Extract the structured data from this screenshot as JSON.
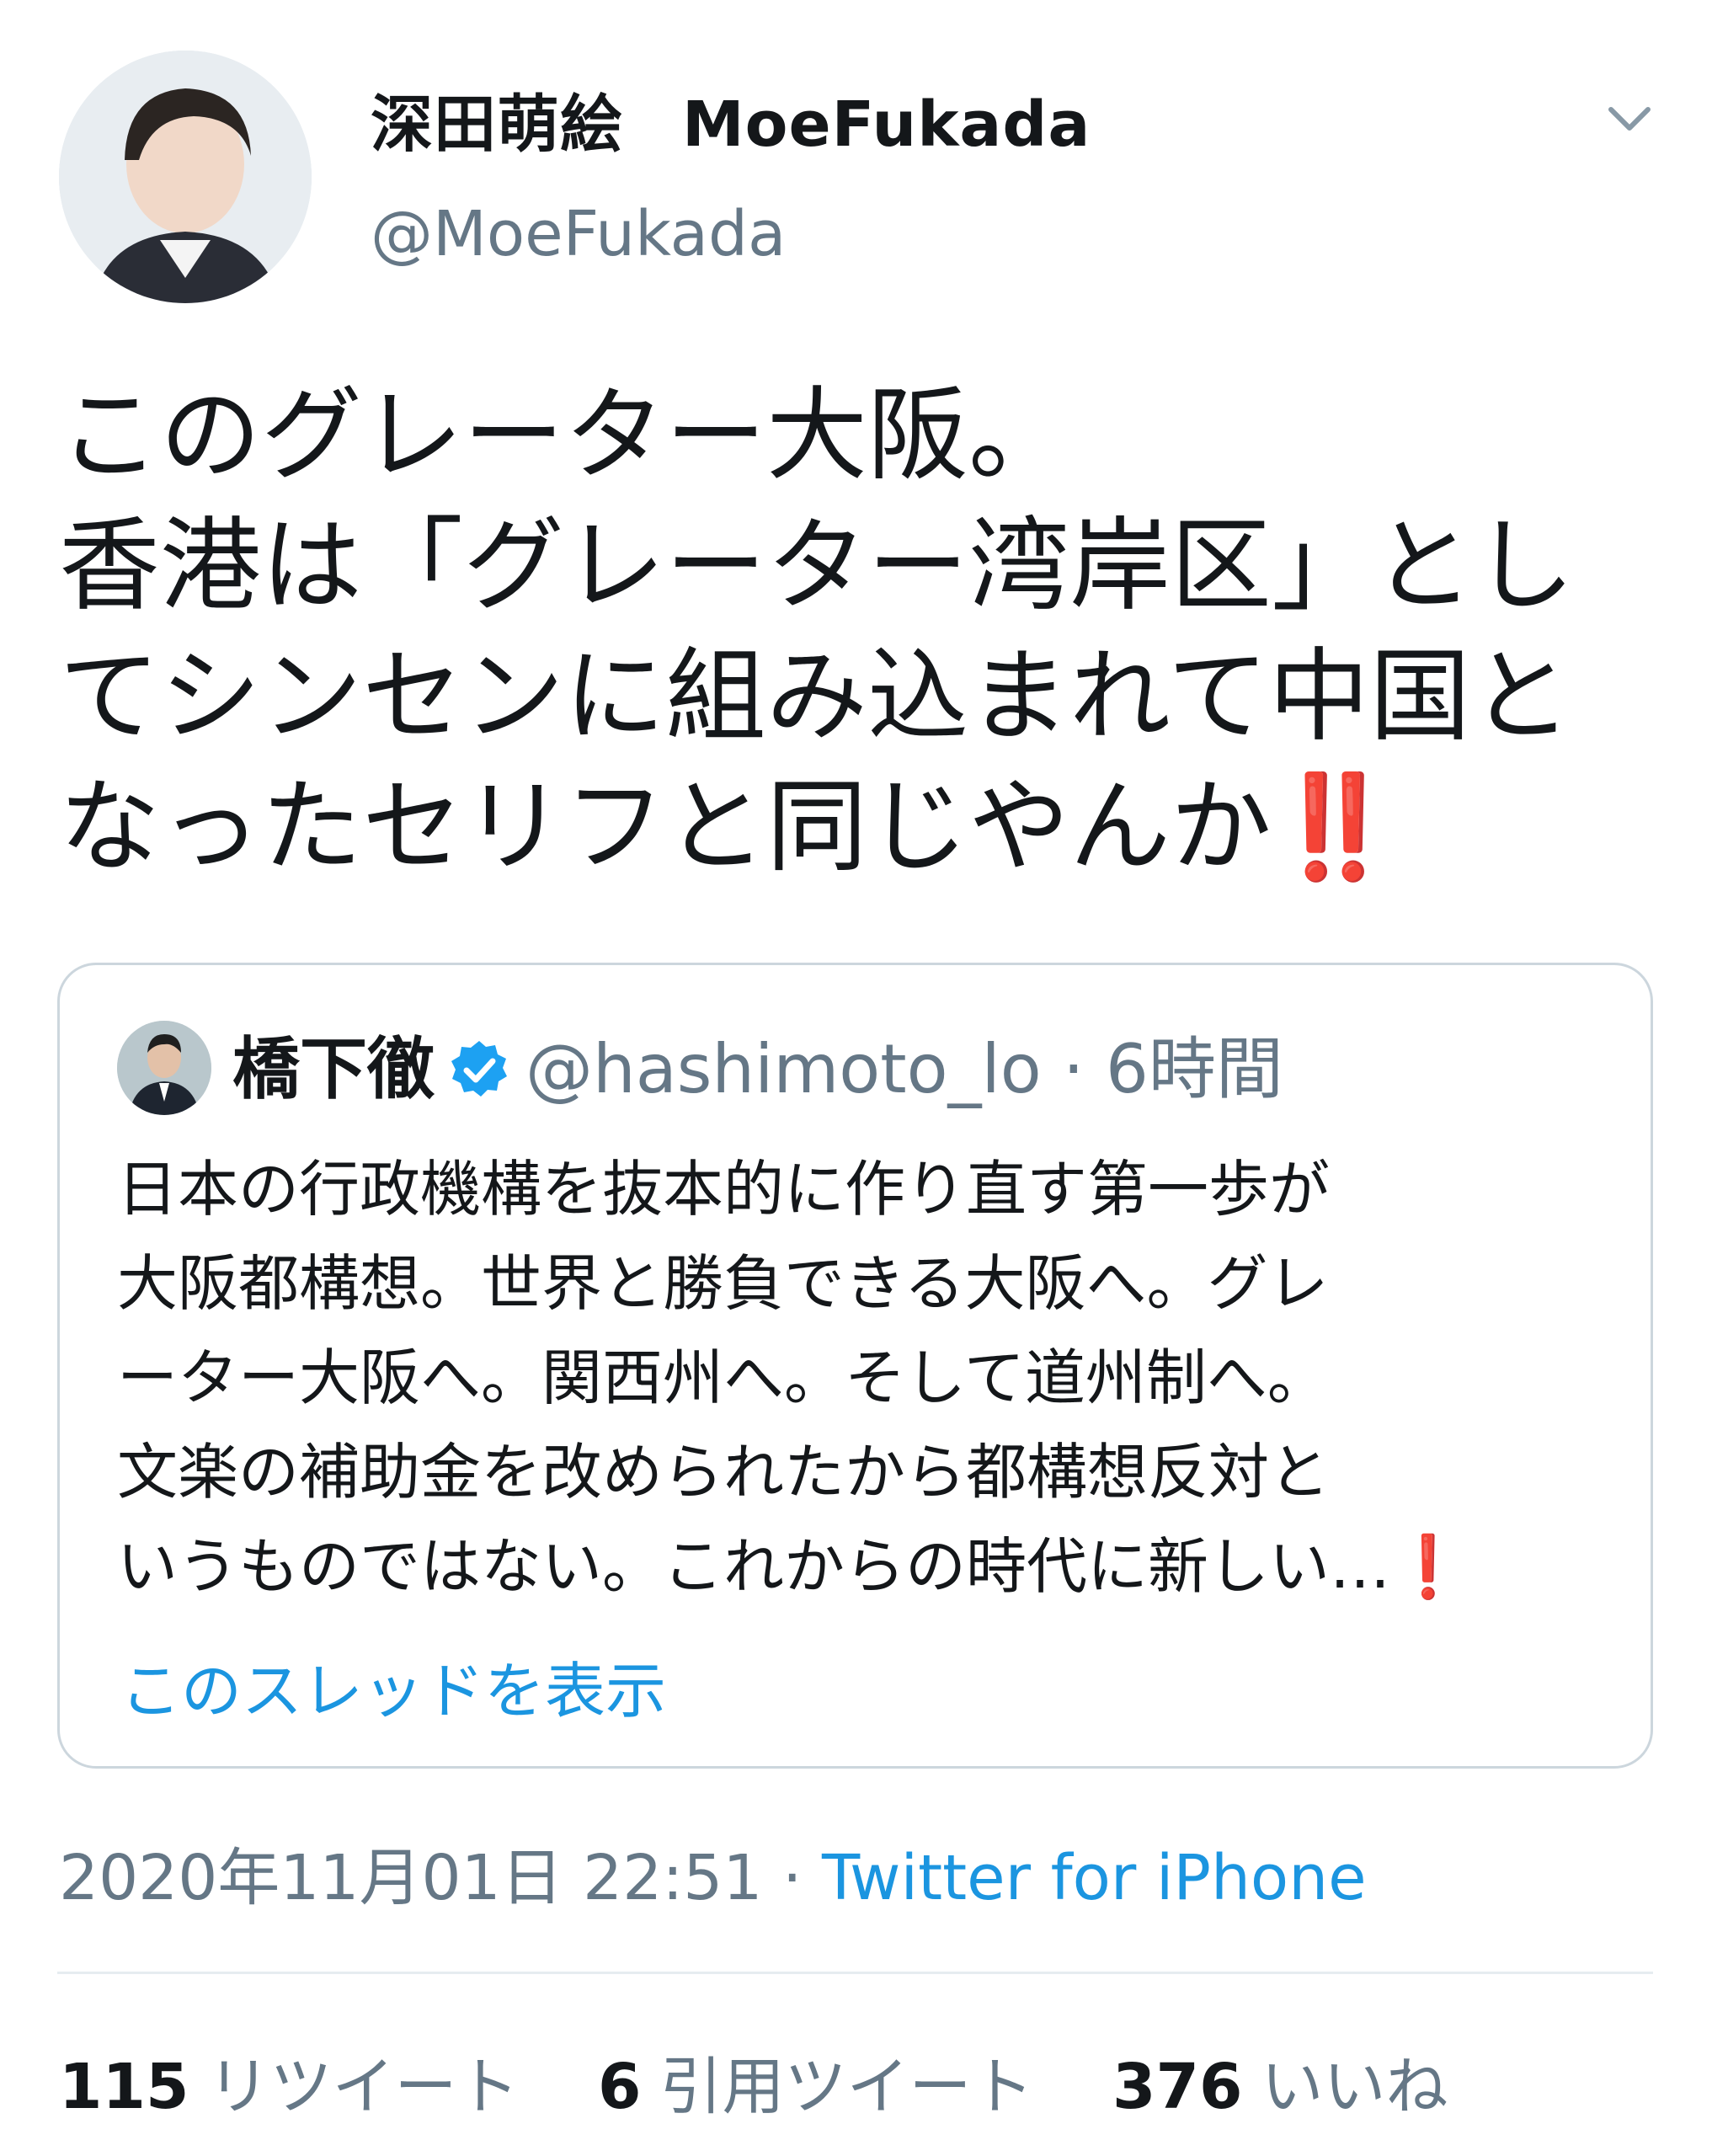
{
  "author": {
    "display_name_ja": "深田萌絵",
    "display_name_latin": "MoeFukada",
    "handle": "@MoeFukada",
    "avatar_icon": "profile-photo"
  },
  "menu_icon": "chevron-down-icon",
  "tweet": {
    "lines": [
      "このグレーター大阪。",
      "香港は「グレーター湾岸区」とし",
      "てシンセンに組み込まれて中国と",
      "なったセリフと同じやんか"
    ],
    "emoji": "‼️"
  },
  "quote": {
    "name": "橋下徹",
    "verified_icon": "verified-badge-icon",
    "handle": "@hashimoto_lo",
    "separator": "·",
    "time": "6時間",
    "lines": [
      "日本の行政機構を抜本的に作り直す第一歩が",
      "大阪都構想。世界と勝負できる大阪へ。グレ",
      "ーター大阪へ。関西州へ。そして道州制へ。",
      "文楽の補助金を改められたから都構想反対と",
      "いうものではない。これからの時代に新しい…"
    ],
    "emoji": "❗",
    "show_thread": "このスレッドを表示"
  },
  "meta": {
    "timestamp": "2020年11月01日 22:51",
    "separator": "·",
    "source": "Twitter for iPhone"
  },
  "stats": {
    "retweets_count": "115",
    "retweets_label": "リツイート",
    "quotes_count": "6",
    "quotes_label": "引用ツイート",
    "likes_count": "376",
    "likes_label": "いいね"
  },
  "colors": {
    "text": "#14171a",
    "secondary": "#657786",
    "link": "#1b95e0",
    "verified": "#1da1f2",
    "border": "#ccd6dd",
    "emoji_red": "#d0021b"
  }
}
